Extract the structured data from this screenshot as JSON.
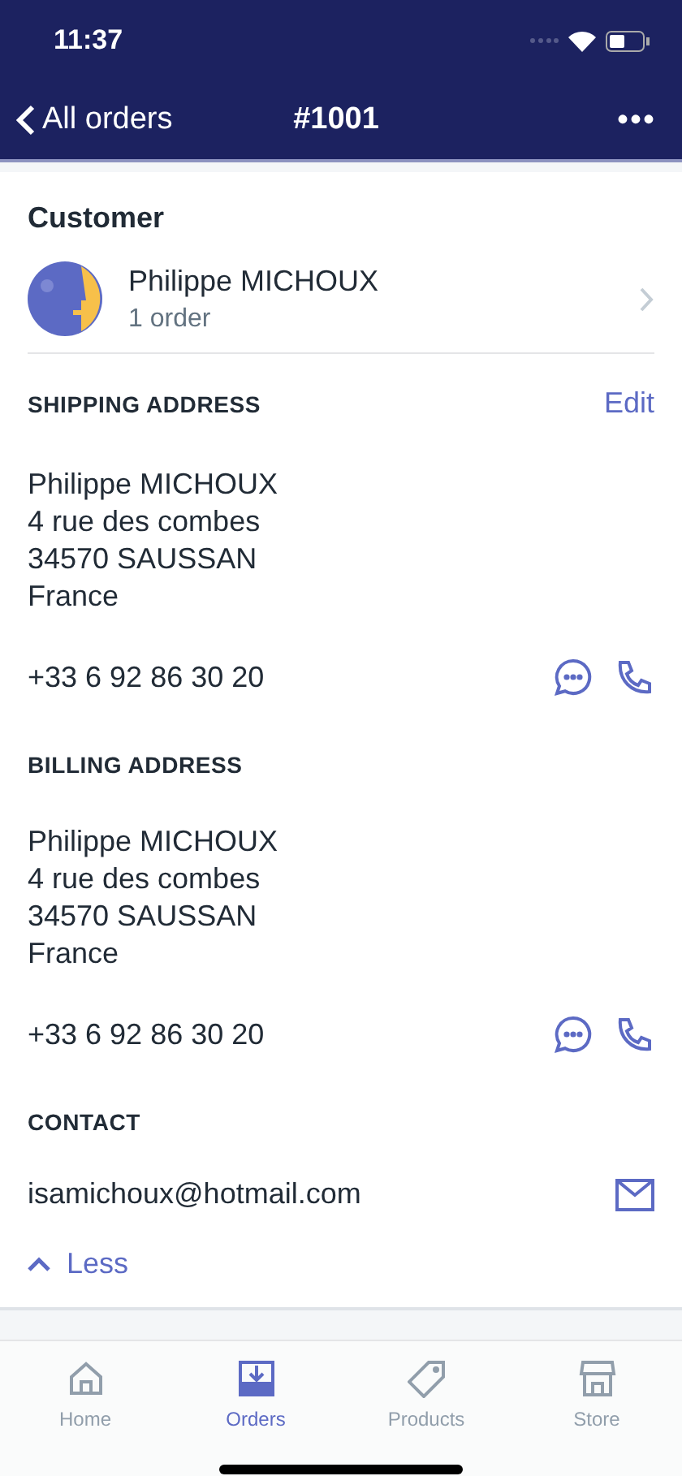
{
  "status_bar": {
    "time": "11:37"
  },
  "nav": {
    "back": "All orders",
    "title": "#1001",
    "more": "•••"
  },
  "customer": {
    "heading": "Customer",
    "name": "Philippe MICHOUX",
    "orders": "1 order"
  },
  "sections": [
    {
      "kind": "address",
      "heading": "SHIPPING ADDRESS",
      "action": "Edit",
      "lines": [
        "Philippe MICHOUX",
        "4 rue des combes",
        "34570 SAUSSAN",
        "France"
      ],
      "phone": "+33 6 92 86 30 20"
    },
    {
      "kind": "address",
      "heading": "BILLING ADDRESS",
      "lines": [
        "Philippe MICHOUX",
        "4 rue des combes",
        "34570 SAUSSAN",
        "France"
      ],
      "phone": "+33 6 92 86 30 20"
    },
    {
      "kind": "contact",
      "heading": "CONTACT",
      "email": "isamichoux@hotmail.com"
    }
  ],
  "toggle": {
    "label": "Less",
    "expanded": true
  },
  "tabs": [
    {
      "label": "Home",
      "selected": false
    },
    {
      "label": "Orders",
      "selected": true
    },
    {
      "label": "Products",
      "selected": false
    },
    {
      "label": "Store",
      "selected": false
    }
  ]
}
